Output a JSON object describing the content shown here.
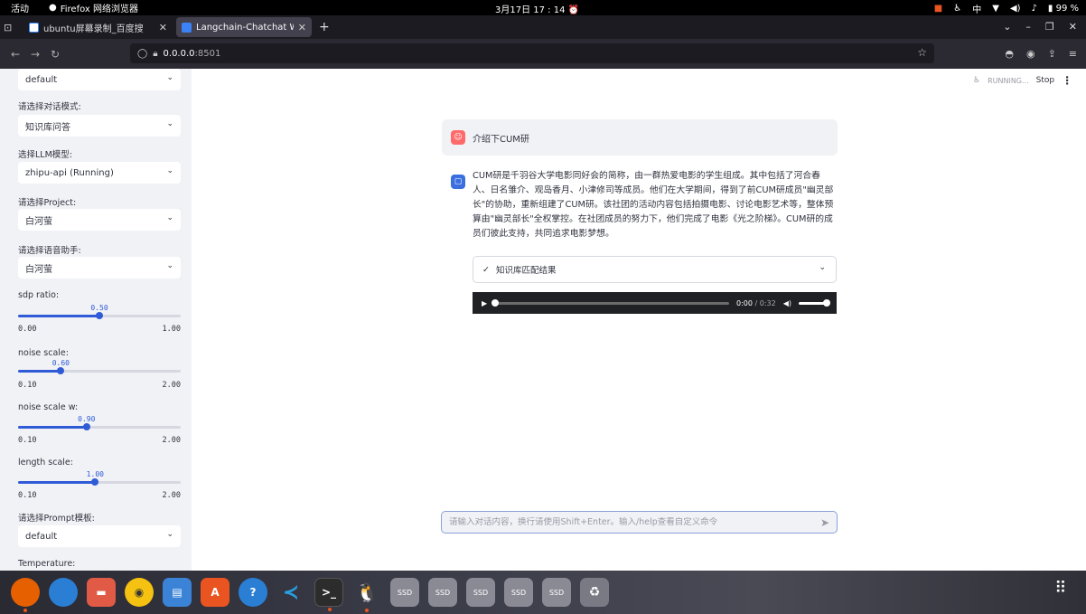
{
  "topbar": {
    "activities": "活动",
    "app_name": "Firefox 网络浏览器",
    "clock": "3月17日 17 : 14",
    "lang": "中",
    "battery": "99 %"
  },
  "tabs": [
    {
      "title": "ubuntu屏幕录制_百度搜",
      "active": false
    },
    {
      "title": "Langchain-Chatchat Web",
      "active": true
    }
  ],
  "url": {
    "host": "0.0.0.0",
    "port": ":8501"
  },
  "sidebar": {
    "knowledge_select": "default",
    "mode_label": "请选择对话模式:",
    "mode_value": "知识库问答",
    "llm_label": "选择LLM模型:",
    "llm_value": "zhipu-api (Running)",
    "project_label": "请选择Project:",
    "project_value": "白河萤",
    "voice_label": "请选择语音助手:",
    "voice_value": "白河萤",
    "sliders": [
      {
        "label": "sdp ratio:",
        "value": "0.50",
        "min": "0.00",
        "max": "1.00",
        "frac": 0.5
      },
      {
        "label": "noise scale:",
        "value": "0.60",
        "min": "0.10",
        "max": "2.00",
        "frac": 0.263
      },
      {
        "label": "noise scale w:",
        "value": "0.90",
        "min": "0.10",
        "max": "2.00",
        "frac": 0.421
      },
      {
        "label": "length scale:",
        "value": "1.00",
        "min": "0.10",
        "max": "2.00",
        "frac": 0.474
      }
    ],
    "prompt_label": "请选择Prompt模板:",
    "prompt_value": "default",
    "temperature_label": "Temperature:"
  },
  "status": {
    "running": "RUNNING...",
    "stop": "Stop"
  },
  "chat": {
    "user_message": "介绍下CUM研",
    "bot_message": "CUM研是千羽谷大学电影同好会的简称，由一群热爱电影的学生组成。其中包括了河合春人、日名雏介、观岛香月、小津修司等成员。他们在大学期间，得到了前CUM研成员\"幽灵部长\"的协助，重新组建了CUM研。该社团的活动内容包括拍摄电影、讨论电影艺术等，整体预算由\"幽灵部长\"全权掌控。在社团成员的努力下，他们完成了电影《光之阶梯》。CUM研的成员们彼此支持，共同追求电影梦想。",
    "expander_label": "知识库匹配结果",
    "audio_current": "0:00",
    "audio_total": "0:32",
    "input_placeholder": "请输入对话内容，换行请使用Shift+Enter。输入/help查看自定义命令"
  },
  "dock": {
    "ssd_label": "SSD"
  }
}
